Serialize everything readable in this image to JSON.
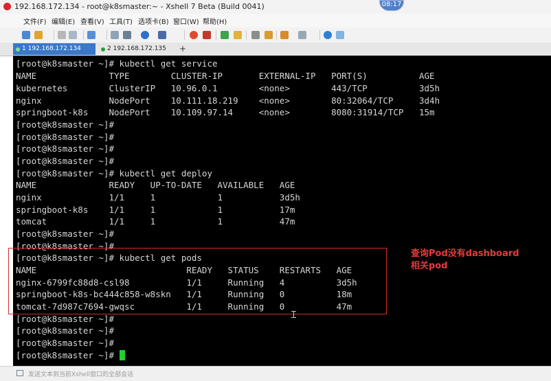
{
  "window": {
    "title": "192.168.172.134 - root@k8smaster:~ - Xshell 7 Beta (Build 0041)",
    "clock": "08:17"
  },
  "menu": [
    "文件(F)",
    "编辑(E)",
    "查看(V)",
    "工具(T)",
    "选项卡(B)",
    "窗口(W)",
    "帮助(H)"
  ],
  "tabs": [
    {
      "label": "1 192.168.172.134",
      "active": true
    },
    {
      "label": "2 192.168.172.135",
      "active": false
    }
  ],
  "tab_add": "+",
  "terminal": {
    "lines": [
      "[root@k8smaster ~]# kubectl get service",
      "NAME              TYPE        CLUSTER-IP       EXTERNAL-IP   PORT(S)          AGE",
      "kubernetes        ClusterIP   10.96.0.1        <none>        443/TCP          3d5h",
      "nginx             NodePort    10.111.18.219    <none>        80:32064/TCP     3d4h",
      "springboot-k8s    NodePort    10.109.97.14     <none>        8080:31914/TCP   15m",
      "[root@k8smaster ~]#",
      "[root@k8smaster ~]#",
      "[root@k8smaster ~]#",
      "[root@k8smaster ~]#",
      "[root@k8smaster ~]# kubectl get deploy",
      "NAME              READY   UP-TO-DATE   AVAILABLE   AGE",
      "nginx             1/1     1            1           3d5h",
      "springboot-k8s    1/1     1            1           17m",
      "tomcat            1/1     1            1           47m",
      "[root@k8smaster ~]#",
      "[root@k8smaster ~]#",
      "[root@k8smaster ~]# kubectl get pods",
      "NAME                             READY   STATUS    RESTARTS   AGE",
      "nginx-6799fc88d8-csl98           1/1     Running   4          3d5h",
      "springboot-k8s-bc444c858-w8skn   1/1     Running   0          18m",
      "tomcat-7d987c7694-gwqsc          1/1     Running   0          47m",
      "[root@k8smaster ~]#",
      "[root@k8smaster ~]#",
      "[root@k8smaster ~]#",
      "[root@k8smaster ~]# "
    ],
    "cursor_color": "#22d12a"
  },
  "annotation": "查询Pod没有dashboard\n相关pod",
  "status_text": "发送文本到当前Xshell窗口的全部会话",
  "colors": {
    "annotation": "#e8393d",
    "highlight_border": "#d62a2a",
    "active_tab": "#3a78c8",
    "terminal_bg": "#000000",
    "terminal_fg": "#d6d6d6"
  },
  "icons": [
    "new-session-icon",
    "open-folder-icon",
    "properties-icon",
    "reconnect-icon",
    "copy-icon",
    "search-icon",
    "print-icon",
    "globe-icon",
    "color-scheme-icon",
    "xftp-icon",
    "compose-icon",
    "fullscreen-icon",
    "lock-icon",
    "keyboard-icon",
    "script-icon",
    "send-icon",
    "layout-icon",
    "help-icon",
    "chat-icon"
  ]
}
